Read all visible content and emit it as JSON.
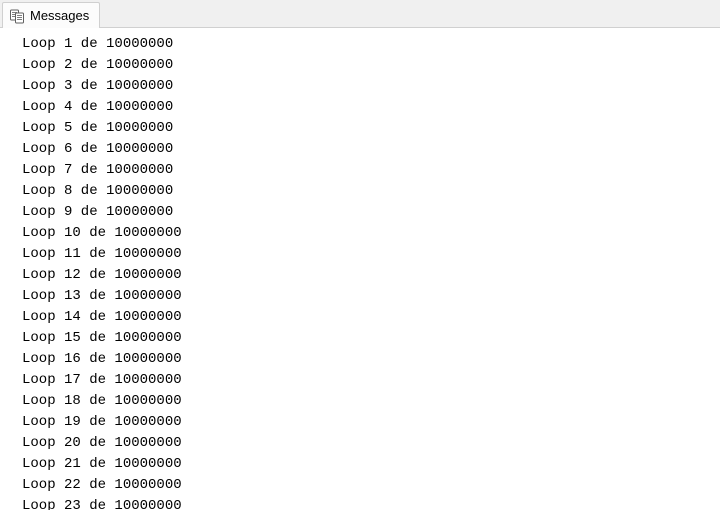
{
  "tab": {
    "label": "Messages",
    "icon_name": "messages-icon"
  },
  "messages": {
    "prefix": "Loop",
    "joiner": "de",
    "total": "10000000",
    "lines": [
      {
        "n": "1"
      },
      {
        "n": "2"
      },
      {
        "n": "3"
      },
      {
        "n": "4"
      },
      {
        "n": "5"
      },
      {
        "n": "6"
      },
      {
        "n": "7"
      },
      {
        "n": "8"
      },
      {
        "n": "9"
      },
      {
        "n": "10"
      },
      {
        "n": "11"
      },
      {
        "n": "12"
      },
      {
        "n": "13"
      },
      {
        "n": "14"
      },
      {
        "n": "15"
      },
      {
        "n": "16"
      },
      {
        "n": "17"
      },
      {
        "n": "18"
      },
      {
        "n": "19"
      },
      {
        "n": "20"
      },
      {
        "n": "21"
      },
      {
        "n": "22"
      },
      {
        "n": "23"
      }
    ]
  }
}
